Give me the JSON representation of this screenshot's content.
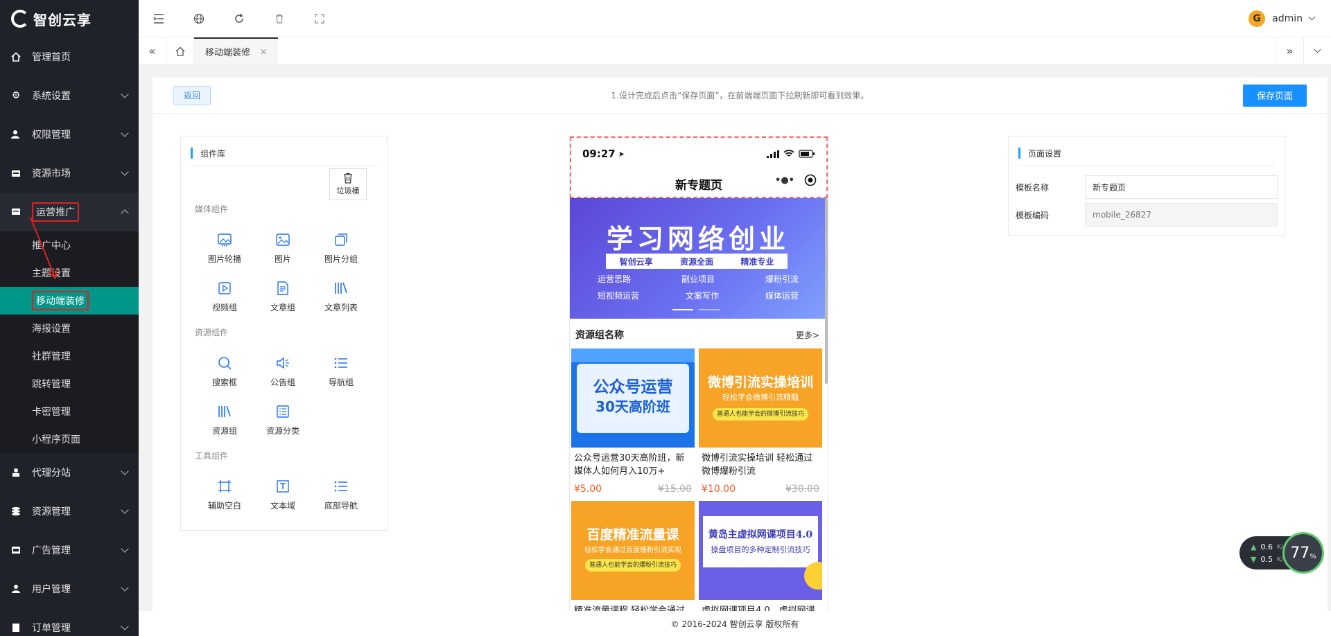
{
  "brand": {
    "name": "智创云享"
  },
  "sidebar": {
    "menu": [
      {
        "label": "管理首页",
        "icon": "home-icon"
      },
      {
        "label": "系统设置",
        "icon": "gear-icon"
      },
      {
        "label": "权限管理",
        "icon": "user-lock-icon"
      },
      {
        "label": "资源市场",
        "icon": "store-icon"
      },
      {
        "label": "运营推广",
        "icon": "megaphone-icon"
      },
      {
        "label": "代理分站",
        "icon": "agent-icon"
      },
      {
        "label": "资源管理",
        "icon": "database-icon"
      },
      {
        "label": "广告管理",
        "icon": "ad-icon"
      },
      {
        "label": "用户管理",
        "icon": "user-icon"
      },
      {
        "label": "订单管理",
        "icon": "order-icon"
      }
    ],
    "submenu": [
      "推广中心",
      "主题设置",
      "移动端装修",
      "海报设置",
      "社群管理",
      "跳转管理",
      "卡密管理",
      "小程序页面"
    ]
  },
  "topbar": {
    "username": "admin"
  },
  "tabs": {
    "current": "移动端装修"
  },
  "toolbar": {
    "back_label": "返回",
    "hint": "1.设计完成后点击“保存页面”，在前端端页面下拉刷新即可看到效果。",
    "save_label": "保存页面"
  },
  "library": {
    "title": "组件库",
    "trash_label": "垃圾桶",
    "sections": [
      {
        "title": "媒体组件",
        "items": [
          "图片轮播",
          "图片",
          "图片分组",
          "视频组",
          "文章组",
          "文章列表"
        ]
      },
      {
        "title": "资源组件",
        "items": [
          "搜索框",
          "公告组",
          "导航组",
          "资源组",
          "资源分类"
        ]
      },
      {
        "title": "工具组件",
        "items": [
          "辅助空白",
          "文本域",
          "底部导航"
        ]
      }
    ]
  },
  "phone": {
    "time": "09:27",
    "page_title": "新专题页",
    "banner": {
      "title": "学习网络创业",
      "subtitle": [
        "智创云享",
        "资源全面",
        "精准专业"
      ],
      "tags_row1": [
        "运营思路",
        "副业项目",
        "爆粉引流"
      ],
      "tags_row2": [
        "短视频运营",
        "文案写作",
        "媒体运营"
      ]
    },
    "group_title": "资源组名称",
    "more_label": "更多>",
    "products": [
      {
        "name": "公众号运营30天高阶班，新媒体人如何月入10万+",
        "price": "¥5.00",
        "old_price": "¥15.00",
        "img_title": "公众号运营",
        "img_sub": "30天高阶班",
        "bg": "#1a73e8"
      },
      {
        "name": "微博引流实操培训 轻松通过微博爆粉引流",
        "price": "¥10.00",
        "old_price": "¥30.00",
        "img_title": "微博引流实操培训",
        "img_sub": "轻松学会微博引流精髓",
        "img_tag": "普通人也能学会的微博引流技巧",
        "bg": "#f7a325"
      },
      {
        "name": "精准流量课程 轻松学会通过",
        "img_title": "百度精准流量课",
        "img_sub": "轻松学会通过百度爆粉引流实现",
        "img_tag": "普通人也能学会的爆粉引流技巧",
        "bg": "#f7a325"
      },
      {
        "name": "虚拟网课项目4.0，虚拟网课",
        "img_title": "黄岛主虚拟网课项目4.0",
        "img_sub": "操盘项目的多种定制引流技巧",
        "bg": "#6a60e8"
      }
    ]
  },
  "settings": {
    "title": "页面设置",
    "name_label": "模板名称",
    "name_value": "新专题页",
    "code_label": "模板编码",
    "code_placeholder": "mobile_26827"
  },
  "footer": {
    "copyright": "© 2016-2024 智创云享 版权所有"
  },
  "net": {
    "up": "0.6",
    "down": "0.5",
    "unit": "K/s",
    "percent": "77",
    "pct_sign": "%"
  },
  "colors": {
    "sidebar_bg": "#20222a",
    "active_green": "#009688",
    "primary_blue": "#1890ff",
    "price_orange": "#ff5722"
  }
}
